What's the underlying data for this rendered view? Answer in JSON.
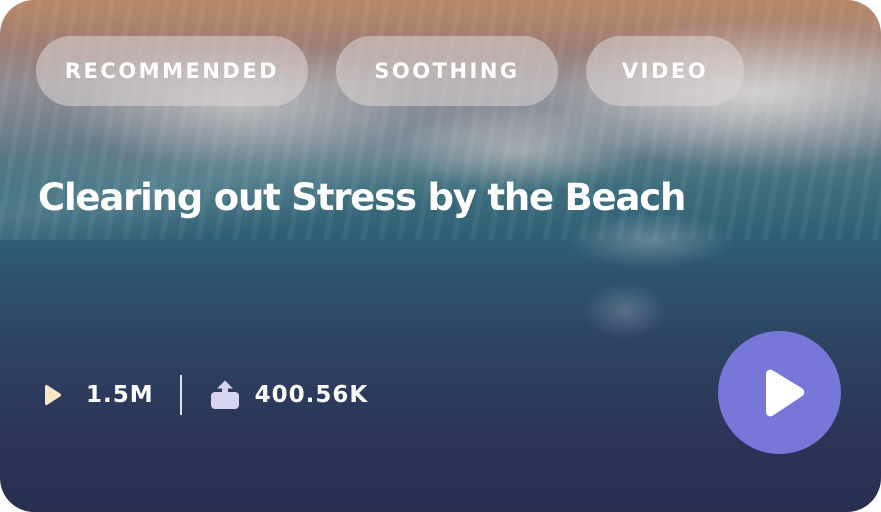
{
  "card": {
    "tags": [
      {
        "label": "RECOMMENDED"
      },
      {
        "label": "SOOTHING"
      },
      {
        "label": "VIDEO"
      }
    ],
    "title": "Clearing out Stress by the Beach",
    "stats": {
      "views": "1.5M",
      "shares": "400.56K"
    },
    "icons": {
      "views": "play-icon",
      "shares": "share-icon",
      "action": "play-icon"
    },
    "colors": {
      "accent": "#7777d9",
      "play_icon": "#fbe7c6",
      "share_icon": "#d6d4f0",
      "tag_background": "#dcd6d6"
    }
  }
}
